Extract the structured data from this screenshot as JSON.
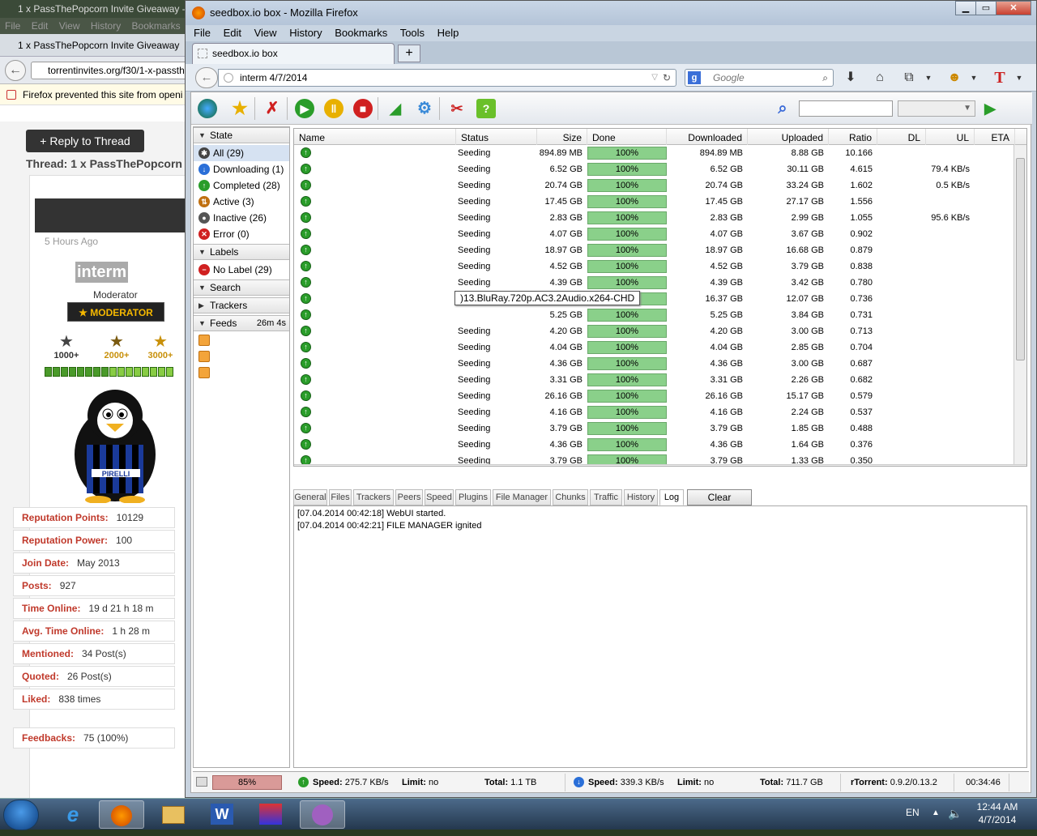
{
  "back_window": {
    "title": "1 x PassThePopcorn Invite Giveaway -",
    "menu": [
      "File",
      "Edit",
      "View",
      "History",
      "Bookmarks"
    ],
    "tab_title": "1 x PassThePopcorn Invite Giveaway",
    "url": "torrentinvites.org/f30/1-x-passth",
    "notification": "Firefox prevented this site from openi",
    "reply_button": "+ Reply to Thread",
    "thread_title": "Thread: 1 x PassThePopcorn",
    "post_time": "5 Hours Ago",
    "username": "interm",
    "user_role": "Moderator",
    "badge": "★ MODERATOR",
    "star_labels": [
      "1000+",
      "2000+",
      "3000+"
    ],
    "stats": [
      {
        "label": "Reputation Points:",
        "value": "10129"
      },
      {
        "label": "Reputation Power:",
        "value": "100"
      },
      {
        "label": "Join Date:",
        "value": "May 2013"
      },
      {
        "label": "Posts:",
        "value": "927"
      },
      {
        "label": "Time Online:",
        "value": "19 d 21 h 18 m"
      },
      {
        "label": "Avg. Time Online:",
        "value": "1 h 28 m"
      },
      {
        "label": "Mentioned:",
        "value": "34 Post(s)"
      },
      {
        "label": "Quoted:",
        "value": "26 Post(s)"
      },
      {
        "label": "Liked:",
        "value": "838 times"
      }
    ],
    "feedbacks": {
      "label": "Feedbacks:",
      "value": "75 (100%)"
    }
  },
  "main_window": {
    "title": "seedbox.io box - Mozilla Firefox",
    "menu": [
      "File",
      "Edit",
      "View",
      "History",
      "Bookmarks",
      "Tools",
      "Help"
    ],
    "tab_title": "seedbox.io box",
    "new_tab": "+",
    "url": "interm 4/7/2014",
    "search_placeholder": "Google"
  },
  "sidebar": {
    "state_header": "State",
    "state_items": [
      {
        "label": "All (29)",
        "icon": "all-icon",
        "color": "#444444"
      },
      {
        "label": "Downloading (1)",
        "icon": "downloading-icon",
        "color": "#2a6fd8"
      },
      {
        "label": "Completed (28)",
        "icon": "completed-icon",
        "color": "#2a9d2a"
      },
      {
        "label": "Active (3)",
        "icon": "active-icon",
        "color": "#c07010"
      },
      {
        "label": "Inactive (26)",
        "icon": "inactive-icon",
        "color": "#555555"
      },
      {
        "label": "Error (0)",
        "icon": "error-icon",
        "color": "#d02020"
      }
    ],
    "labels_header": "Labels",
    "label_items": [
      {
        "label": "No Label (29)"
      }
    ],
    "search_header": "Search",
    "trackers_header": "Trackers",
    "feeds_header": "Feeds",
    "feeds_time": "26m 4s"
  },
  "table": {
    "headers": [
      "Name",
      "Status",
      "Size",
      "Done",
      "Downloaded",
      "Uploaded",
      "Ratio",
      "DL",
      "UL",
      "ETA"
    ],
    "tooltip": ")13.BluRay.720p.AC3.2Audio.x264-CHD",
    "rows": [
      {
        "status": "Seeding",
        "size": "894.89 MB",
        "done": "100%",
        "downloaded": "894.89 MB",
        "uploaded": "8.88 GB",
        "ratio": "10.166",
        "dl": "",
        "ul": ""
      },
      {
        "status": "Seeding",
        "size": "6.52 GB",
        "done": "100%",
        "downloaded": "6.52 GB",
        "uploaded": "30.11 GB",
        "ratio": "4.615",
        "dl": "",
        "ul": "79.4 KB/s"
      },
      {
        "status": "Seeding",
        "size": "20.74 GB",
        "done": "100%",
        "downloaded": "20.74 GB",
        "uploaded": "33.24 GB",
        "ratio": "1.602",
        "dl": "",
        "ul": "0.5 KB/s"
      },
      {
        "status": "Seeding",
        "size": "17.45 GB",
        "done": "100%",
        "downloaded": "17.45 GB",
        "uploaded": "27.17 GB",
        "ratio": "1.556",
        "dl": "",
        "ul": ""
      },
      {
        "status": "Seeding",
        "size": "2.83 GB",
        "done": "100%",
        "downloaded": "2.83 GB",
        "uploaded": "2.99 GB",
        "ratio": "1.055",
        "dl": "",
        "ul": "95.6 KB/s"
      },
      {
        "status": "Seeding",
        "size": "4.07 GB",
        "done": "100%",
        "downloaded": "4.07 GB",
        "uploaded": "3.67 GB",
        "ratio": "0.902",
        "dl": "",
        "ul": ""
      },
      {
        "status": "Seeding",
        "size": "18.97 GB",
        "done": "100%",
        "downloaded": "18.97 GB",
        "uploaded": "16.68 GB",
        "ratio": "0.879",
        "dl": "",
        "ul": ""
      },
      {
        "status": "Seeding",
        "size": "4.52 GB",
        "done": "100%",
        "downloaded": "4.52 GB",
        "uploaded": "3.79 GB",
        "ratio": "0.838",
        "dl": "",
        "ul": ""
      },
      {
        "status": "Seeding",
        "size": "4.39 GB",
        "done": "100%",
        "downloaded": "4.39 GB",
        "uploaded": "3.42 GB",
        "ratio": "0.780",
        "dl": "",
        "ul": ""
      },
      {
        "status": "",
        "size": "",
        "done": "100%",
        "downloaded": "16.37 GB",
        "uploaded": "12.07 GB",
        "ratio": "0.736",
        "dl": "",
        "ul": ""
      },
      {
        "status": "",
        "size": "5.25 GB",
        "done": "100%",
        "downloaded": "5.25 GB",
        "uploaded": "3.84 GB",
        "ratio": "0.731",
        "dl": "",
        "ul": ""
      },
      {
        "status": "Seeding",
        "size": "4.20 GB",
        "done": "100%",
        "downloaded": "4.20 GB",
        "uploaded": "3.00 GB",
        "ratio": "0.713",
        "dl": "",
        "ul": ""
      },
      {
        "status": "Seeding",
        "size": "4.04 GB",
        "done": "100%",
        "downloaded": "4.04 GB",
        "uploaded": "2.85 GB",
        "ratio": "0.704",
        "dl": "",
        "ul": ""
      },
      {
        "status": "Seeding",
        "size": "4.36 GB",
        "done": "100%",
        "downloaded": "4.36 GB",
        "uploaded": "3.00 GB",
        "ratio": "0.687",
        "dl": "",
        "ul": ""
      },
      {
        "status": "Seeding",
        "size": "3.31 GB",
        "done": "100%",
        "downloaded": "3.31 GB",
        "uploaded": "2.26 GB",
        "ratio": "0.682",
        "dl": "",
        "ul": ""
      },
      {
        "status": "Seeding",
        "size": "26.16 GB",
        "done": "100%",
        "downloaded": "26.16 GB",
        "uploaded": "15.17 GB",
        "ratio": "0.579",
        "dl": "",
        "ul": ""
      },
      {
        "status": "Seeding",
        "size": "4.16 GB",
        "done": "100%",
        "downloaded": "4.16 GB",
        "uploaded": "2.24 GB",
        "ratio": "0.537",
        "dl": "",
        "ul": ""
      },
      {
        "status": "Seeding",
        "size": "3.79 GB",
        "done": "100%",
        "downloaded": "3.79 GB",
        "uploaded": "1.85 GB",
        "ratio": "0.488",
        "dl": "",
        "ul": ""
      },
      {
        "status": "Seeding",
        "size": "4.36 GB",
        "done": "100%",
        "downloaded": "4.36 GB",
        "uploaded": "1.64 GB",
        "ratio": "0.376",
        "dl": "",
        "ul": ""
      },
      {
        "status": "Seeding",
        "size": "3.79 GB",
        "done": "100%",
        "downloaded": "3.79 GB",
        "uploaded": "1.33 GB",
        "ratio": "0.350",
        "dl": "",
        "ul": ""
      }
    ]
  },
  "detail_tabs": [
    "General",
    "Files",
    "Trackers",
    "Peers",
    "Speed",
    "Plugins",
    "File Manager",
    "Chunks",
    "Traffic",
    "History",
    "Log"
  ],
  "clear_button": "Clear",
  "log_lines": [
    "[07.04.2014 00:42:18] WebUI started.",
    "[07.04.2014 00:42:21] FILE MANAGER ignited"
  ],
  "status_bar": {
    "disk_percent": "85%",
    "up_speed_label": "Speed:",
    "up_speed": "275.7 KB/s",
    "up_limit_label": "Limit:",
    "up_limit": "no",
    "up_total_label": "Total:",
    "up_total": "1.1 TB",
    "down_speed_label": "Speed:",
    "down_speed": "339.3 KB/s",
    "down_limit_label": "Limit:",
    "down_limit": "no",
    "down_total_label": "Total:",
    "down_total": "711.7 GB",
    "version_label": "rTorrent:",
    "version": "0.9.2/0.13.2",
    "uptime": "00:34:46"
  },
  "taskbar": {
    "language": "EN",
    "time": "12:44 AM",
    "date": "4/7/2014"
  }
}
